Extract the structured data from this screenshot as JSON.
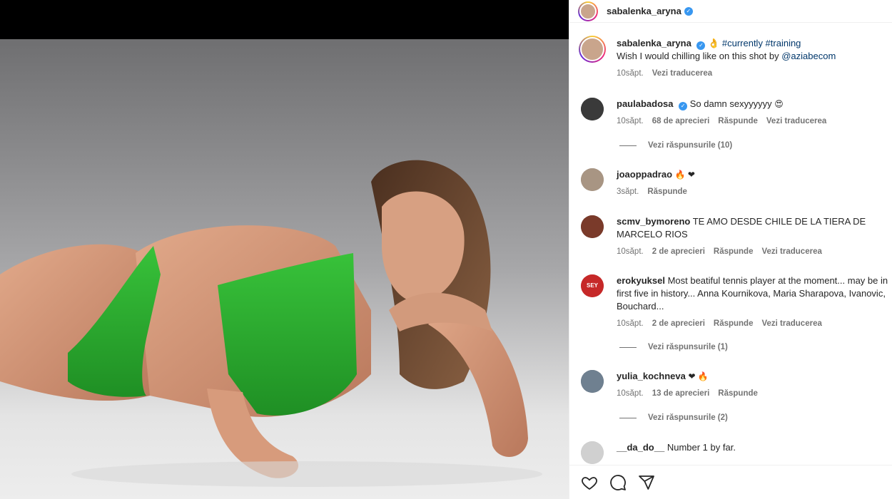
{
  "post": {
    "author": "sabalenka_aryna",
    "caption_emoji": "👌",
    "caption_tags": "#currently #training",
    "caption_text": "Wish I would chilling like on this shot by ",
    "caption_mention": "@aziabecom",
    "time": "10săpt.",
    "translate": "Vezi traducerea"
  },
  "comments": [
    {
      "user": "paulabadosa",
      "verified": true,
      "text": "So damn sexyyyyyy",
      "emoji": "😍",
      "time": "10săpt.",
      "likes": "68 de aprecieri",
      "reply": "Răspunde",
      "translate": "Vezi traducerea",
      "view_replies": "Vezi răspunsurile (10)"
    },
    {
      "user": "joaoppadrao",
      "text": "",
      "emoji": "🔥 ❤",
      "time": "3săpt.",
      "reply": "Răspunde"
    },
    {
      "user": "scmv_bymoreno",
      "text": "TE AMO DESDE CHILE DE LA TIERA DE MARCELO RIOS",
      "time": "10săpt.",
      "likes": "2 de aprecieri",
      "reply": "Răspunde",
      "translate": "Vezi traducerea"
    },
    {
      "user": "erokyuksel",
      "text": "Most beatiful tennis player at the moment... may be in first five in history... Anna Kournikova, Maria Sharapova, Ivanovic, Bouchard...",
      "time": "10săpt.",
      "likes": "2 de aprecieri",
      "reply": "Răspunde",
      "translate": "Vezi traducerea",
      "view_replies": "Vezi răspunsurile (1)",
      "avatar_text": "SEY"
    },
    {
      "user": "yulia_kochneva",
      "text": "",
      "emoji": "❤ 🔥",
      "time": "10săpt.",
      "likes": "13 de aprecieri",
      "reply": "Răspunde",
      "view_replies": "Vezi răspunsurile (2)"
    },
    {
      "user": "__da_do__",
      "text": "Number 1 by far."
    }
  ],
  "icons": {
    "like": "heart-outline-icon",
    "comment": "comment-bubble-icon",
    "share": "paper-plane-icon"
  },
  "colors": {
    "verified": "#3897f0",
    "link": "#00376b",
    "swimsuit": "#2fb233",
    "muted": "#737373"
  }
}
